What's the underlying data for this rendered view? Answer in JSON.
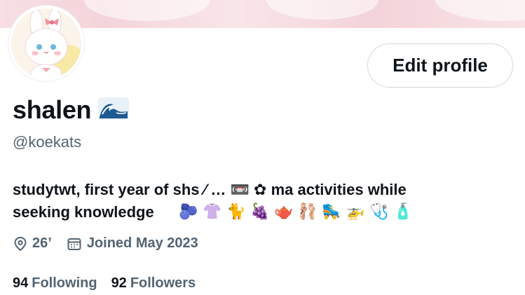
{
  "profile": {
    "display_name": "shalen",
    "name_emoji_icon": "wave-icon",
    "handle": "@koekats",
    "bio_line1": "studytwt, first year of shs ⁄  … 📼 ✿ ma activities while",
    "bio_line2": "seeking knowledge",
    "bio_emojis": [
      "🫐",
      "👚",
      "🐈",
      "🍇",
      "🫖",
      "🩰",
      "🛼",
      "🚁",
      "🩺",
      "🧴"
    ]
  },
  "actions": {
    "edit_profile_label": "Edit profile"
  },
  "meta": {
    "location_icon": "location-pin-icon",
    "location": "26’",
    "calendar_icon": "calendar-icon",
    "joined": "Joined May 2023"
  },
  "stats": {
    "following_count": "94",
    "following_label": "Following",
    "followers_count": "92",
    "followers_label": "Followers"
  }
}
